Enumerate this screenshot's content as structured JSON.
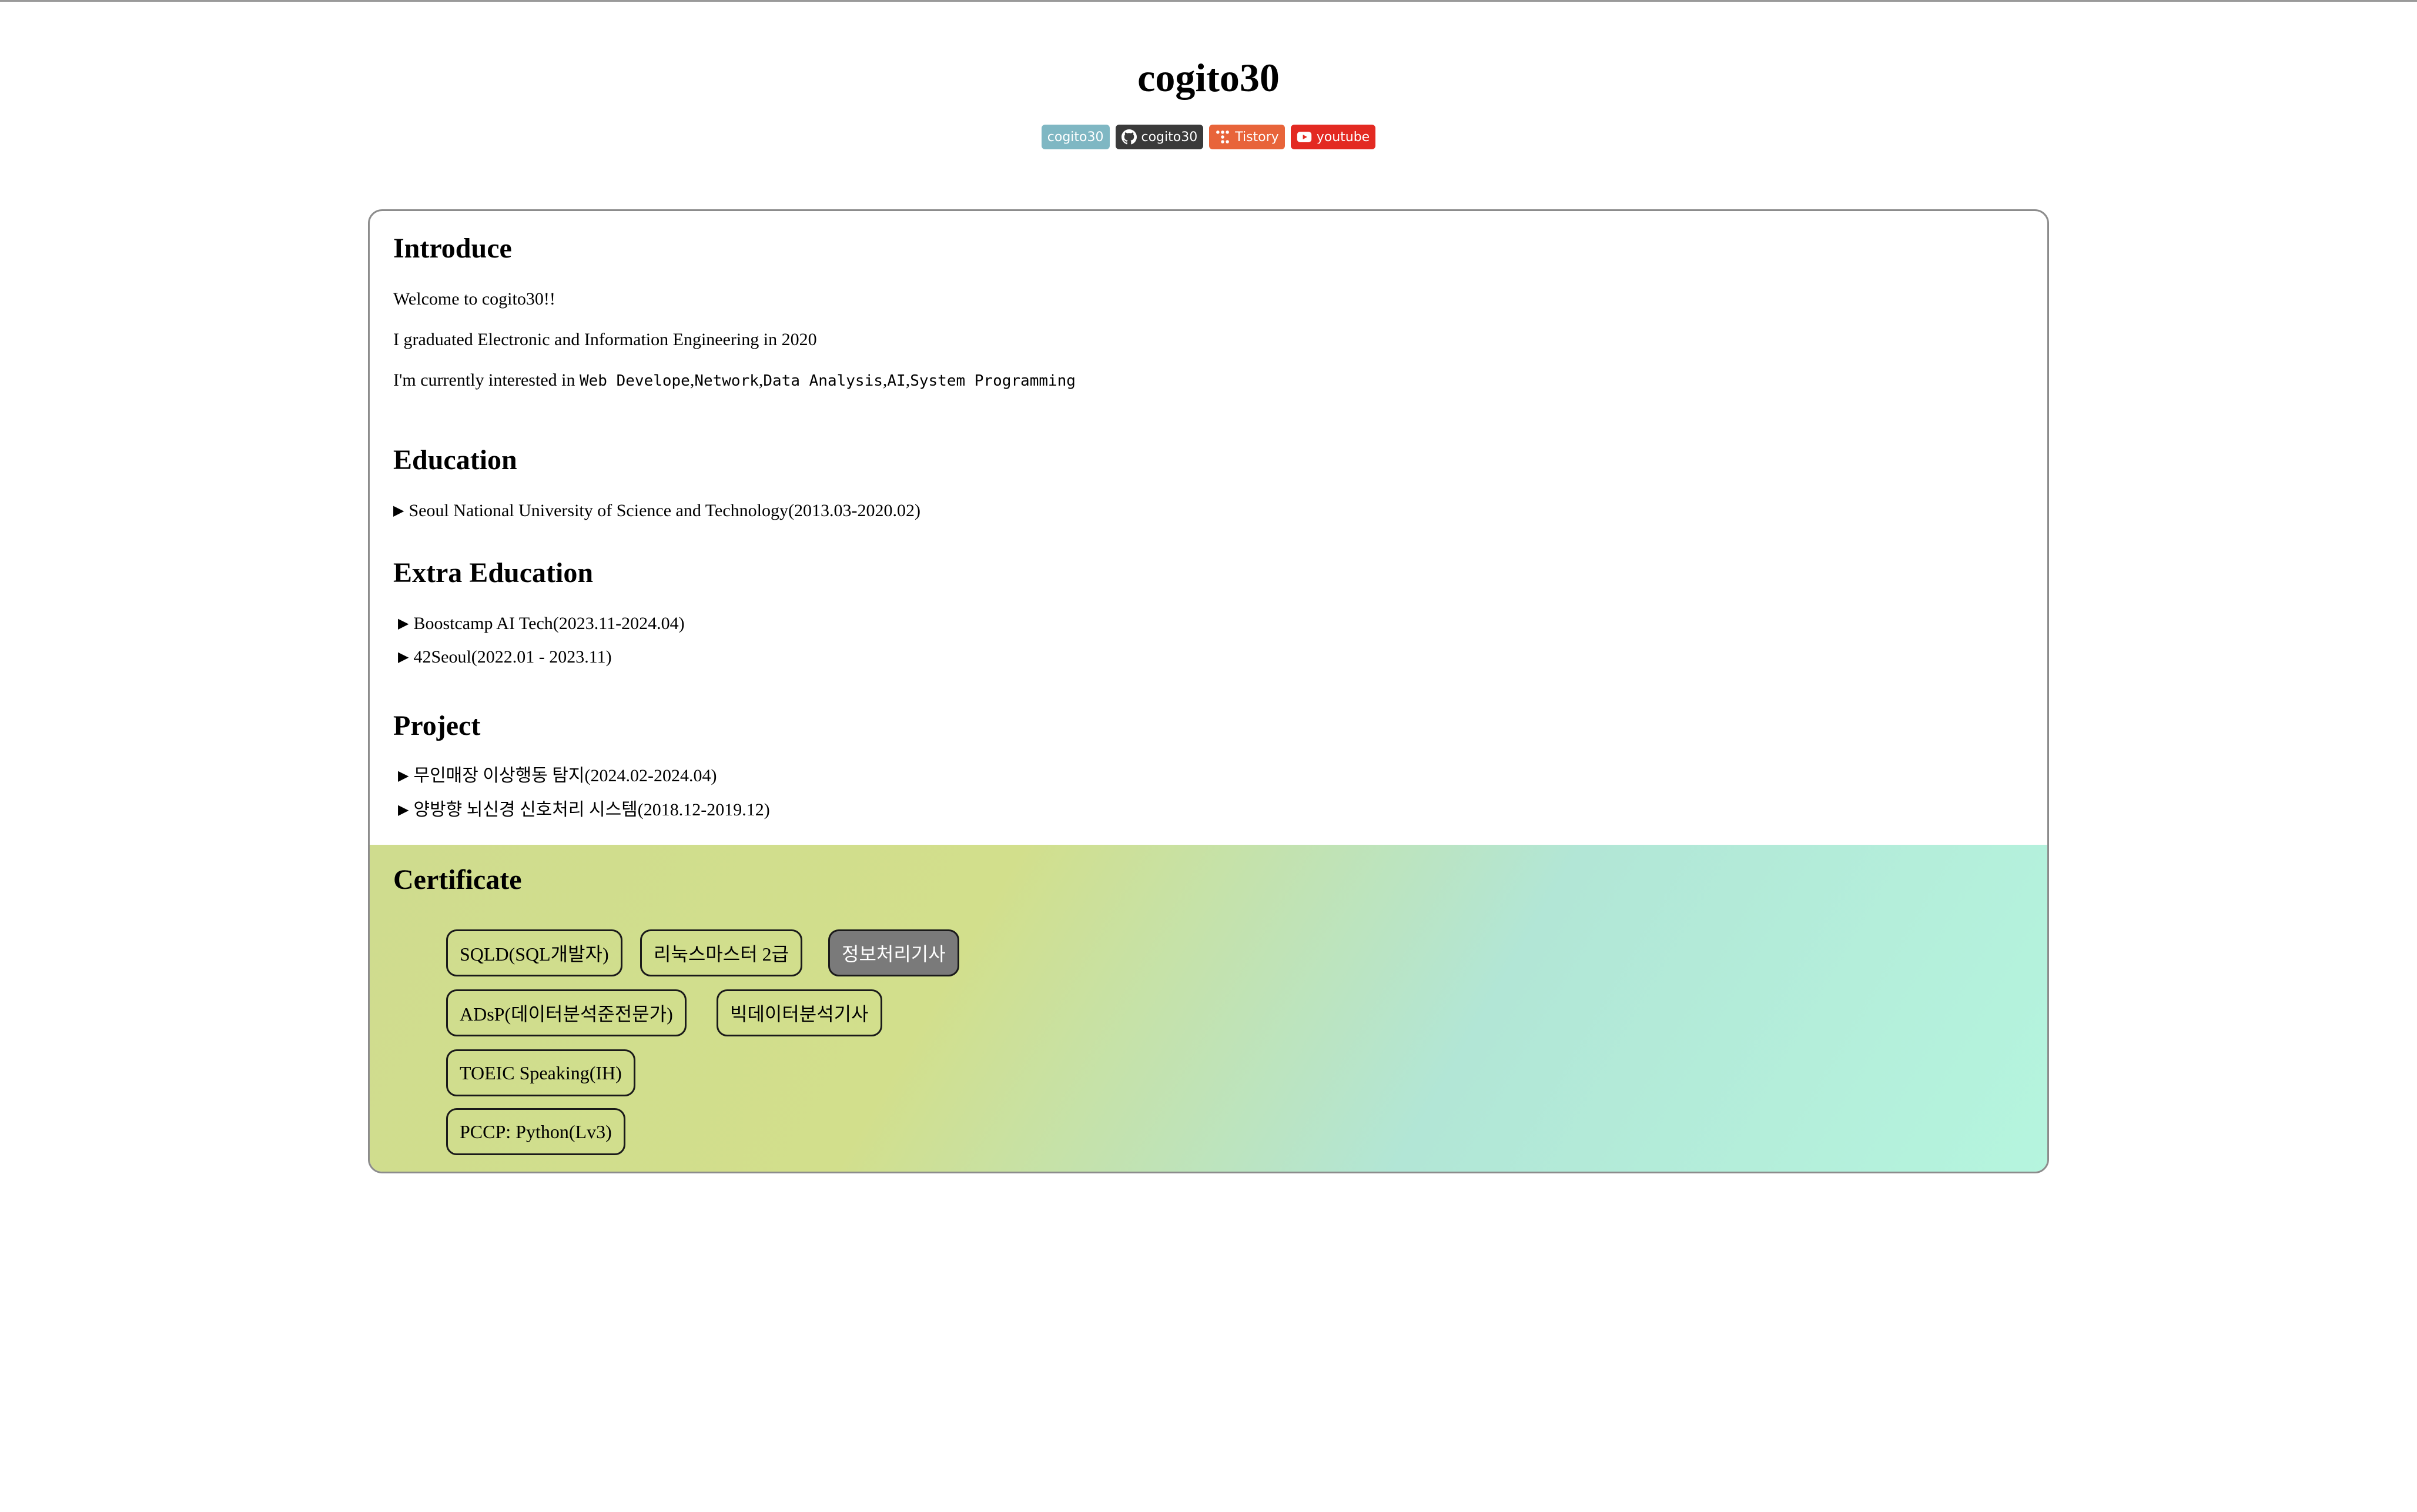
{
  "header": {
    "title": "cogito30",
    "badges": [
      {
        "label": "cogito30",
        "icon": "none",
        "color": "#7fb7c3"
      },
      {
        "label": "cogito30",
        "icon": "github-icon",
        "color": "#3a3a3a"
      },
      {
        "label": "Tistory",
        "icon": "tistory-icon",
        "color": "#e8643a"
      },
      {
        "label": "youtube",
        "icon": "youtube-icon",
        "color": "#e32a22"
      }
    ]
  },
  "introduce": {
    "title": "Introduce",
    "welcome": "Welcome to cogito30!!",
    "graduated": "I graduated Electronic and Information Engineering in 2020",
    "interest_prefix": "I'm currently interested in ",
    "interests": [
      "Web Develope",
      "Network",
      "Data Analysis",
      "AI",
      "System Programming"
    ]
  },
  "education": {
    "title": "Education",
    "items": [
      "Seoul National University of Science and Technology(2013.03-2020.02)"
    ]
  },
  "extra_education": {
    "title": "Extra Education",
    "items": [
      "Boostcamp AI Tech(2023.11-2024.04)",
      "42Seoul(2022.01 - 2023.11)"
    ]
  },
  "project": {
    "title": "Project",
    "items": [
      "무인매장 이상행동 탐지(2024.02-2024.04)",
      "양방향 뇌신경 신호처리 시스템(2018.12-2019.12)"
    ]
  },
  "certificate": {
    "title": "Certificate",
    "rows": [
      [
        {
          "label": "SQLD(SQL개발자)",
          "active": false
        },
        {
          "label": "리눅스마스터 2급",
          "active": false
        },
        {
          "label": "정보처리기사",
          "active": true
        }
      ],
      [
        {
          "label": "ADsP(데이터분석준전문가)",
          "active": false
        },
        {
          "label": "빅데이터분석기사",
          "active": false
        }
      ],
      [
        {
          "label": "TOEIC Speaking(IH)",
          "active": false
        }
      ],
      [
        {
          "label": "PCCP: Python(Lv3)",
          "active": false
        }
      ]
    ]
  },
  "triangle": "▶"
}
